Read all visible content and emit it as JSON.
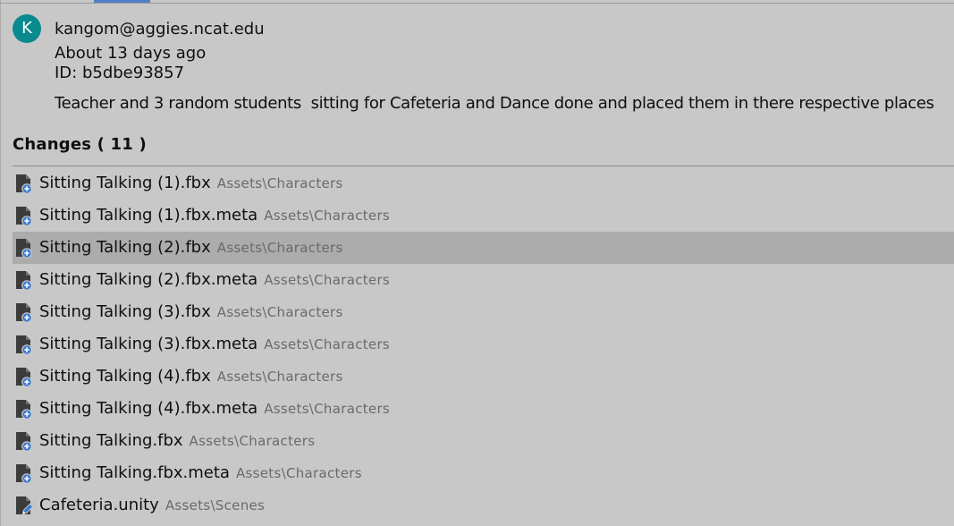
{
  "commit": {
    "avatar_initial": "K",
    "author": "kangom@aggies.ncat.edu",
    "time": "About 13 days ago",
    "id": "ID: b5dbe93857",
    "message": "Teacher and 3 random students  sitting for Cafeteria and Dance done and placed them in there respective places"
  },
  "changes": {
    "heading": "Changes ( 11 )",
    "selected_index": 2,
    "files": [
      {
        "name": "Sitting Talking (1).fbx",
        "path": "Assets\\Characters",
        "status_icon": "file-added-icon"
      },
      {
        "name": "Sitting Talking (1).fbx.meta",
        "path": "Assets\\Characters",
        "status_icon": "file-added-icon"
      },
      {
        "name": "Sitting Talking (2).fbx",
        "path": "Assets\\Characters",
        "status_icon": "file-added-icon"
      },
      {
        "name": "Sitting Talking (2).fbx.meta",
        "path": "Assets\\Characters",
        "status_icon": "file-added-icon"
      },
      {
        "name": "Sitting Talking (3).fbx",
        "path": "Assets\\Characters",
        "status_icon": "file-added-icon"
      },
      {
        "name": "Sitting Talking (3).fbx.meta",
        "path": "Assets\\Characters",
        "status_icon": "file-added-icon"
      },
      {
        "name": "Sitting Talking (4).fbx",
        "path": "Assets\\Characters",
        "status_icon": "file-added-icon"
      },
      {
        "name": "Sitting Talking (4).fbx.meta",
        "path": "Assets\\Characters",
        "status_icon": "file-added-icon"
      },
      {
        "name": "Sitting Talking.fbx",
        "path": "Assets\\Characters",
        "status_icon": "file-added-icon"
      },
      {
        "name": "Sitting Talking.fbx.meta",
        "path": "Assets\\Characters",
        "status_icon": "file-added-icon"
      },
      {
        "name": "Cafeteria.unity",
        "path": "Assets\\Scenes",
        "status_icon": "file-modified-icon"
      }
    ]
  },
  "colors": {
    "avatar": "#0b8a8e",
    "file_icon": "#3c3c3c",
    "status_badge": "#3a7bd5",
    "selected_row": "#acacac",
    "tab_accent": "#4f7fc6"
  }
}
